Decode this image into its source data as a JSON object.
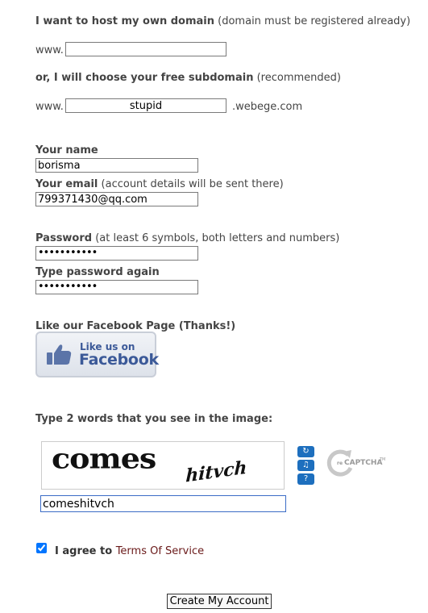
{
  "own_domain": {
    "label": "I want to host my own domain",
    "note": "(domain must be registered already)",
    "prefix": "www.",
    "value": ""
  },
  "subdomain": {
    "label": "or, I will choose your free subdomain",
    "note": "(recommended)",
    "prefix": "www.",
    "value": "stupid",
    "suffix": ".webege.com"
  },
  "name": {
    "label": "Your name",
    "value": "borisma"
  },
  "email": {
    "label": "Your email",
    "note": "(account details will be sent there)",
    "value": "799371430@qq.com"
  },
  "password": {
    "label": "Password",
    "note": "(at least 6 symbols, both letters and numbers)",
    "mask": "•••••••••••"
  },
  "password_again": {
    "label": "Type password again",
    "mask": "•••••••••••"
  },
  "facebook": {
    "label": "Like our Facebook Page (Thanks!)",
    "button_small": "Like us on",
    "button_big": "Facebook",
    "brand_color": "#3b5998"
  },
  "captcha": {
    "label": "Type 2 words that you see in the image:",
    "word1": "comes",
    "word2": "hitvch",
    "brand": "CAPTCHA",
    "brand_prefix": "reCAPTCHA",
    "response": "comeshitvch",
    "accent_color": "#1d6fbe"
  },
  "terms": {
    "checked": true,
    "prefix": "I agree to",
    "link_text": "Terms Of Service",
    "link_color": "#6a1a1a"
  },
  "submit": {
    "label": "Create My Account"
  }
}
